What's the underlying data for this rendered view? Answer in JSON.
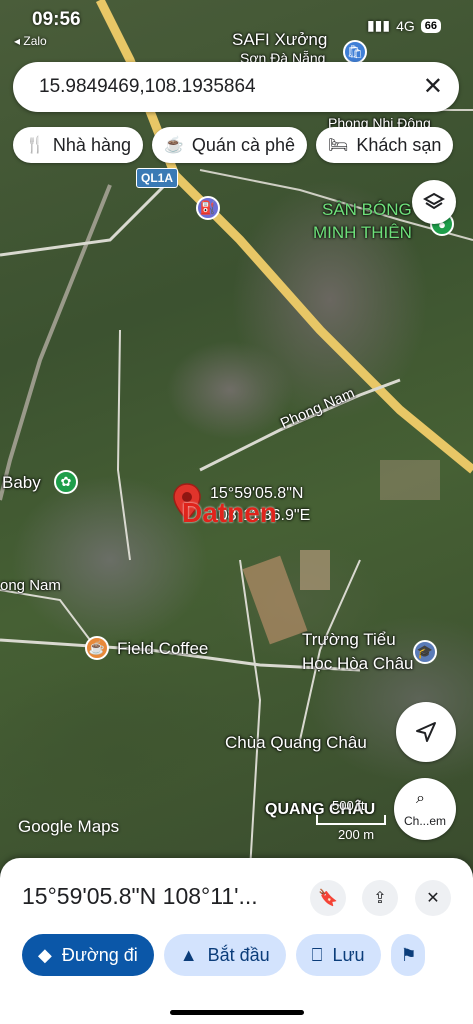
{
  "status_bar": {
    "time": "09:56",
    "back_label": "◂ Zalo",
    "network": "4G",
    "battery": "66"
  },
  "search": {
    "value": "15.9849469,108.1935864",
    "close_icon": "close-icon"
  },
  "chips": [
    {
      "label": "Nhà hàng",
      "icon": "restaurant-icon"
    },
    {
      "label": "Quán cà phê",
      "icon": "coffee-icon"
    },
    {
      "label": "Khách sạn",
      "icon": "hotel-icon"
    }
  ],
  "map": {
    "labels": {
      "safi": "SAFI Xưởng",
      "safi_sub": "Sơn Đà Nẵng",
      "phong_vinh": "Phong Nhị Đông",
      "san_bong_1": "SÂN BÓNG",
      "san_bong_2": "MINH THIÊN",
      "road_ql1a": "QL1A",
      "phong_nam_road": "Phong Nam",
      "baby": "Baby",
      "coord_line1": "15°59'05.8\"N",
      "coord_line2": "108°11'36.9\"E",
      "phong_nam_west": "ong Nam",
      "field_coffee": "Field Coffee",
      "truong_1": "Trường Tiểu",
      "truong_2": "Học Hòa Châu",
      "chua": "Chùa Quang Châu",
      "quang_chau": "QUANG CHÂU",
      "watermark": "Datnen"
    },
    "google_logo": "Google Maps",
    "scale_ft": "500 ft",
    "scale_m": "200 m",
    "lens_label": "Ch...em"
  },
  "sheet": {
    "coordinate": "15°59'05.8\"N 108°11'...",
    "actions": [
      {
        "label": "Đường đi",
        "icon": "directions-icon"
      },
      {
        "label": "Bắt đầu",
        "icon": "navigate-icon"
      },
      {
        "label": "Lưu",
        "icon": "bookmark-icon"
      }
    ]
  },
  "colors": {
    "primary": "#0b57a8",
    "secondary": "#d3e3fd",
    "road_yellow": "#e8c766",
    "pin_red": "#e0342b"
  }
}
